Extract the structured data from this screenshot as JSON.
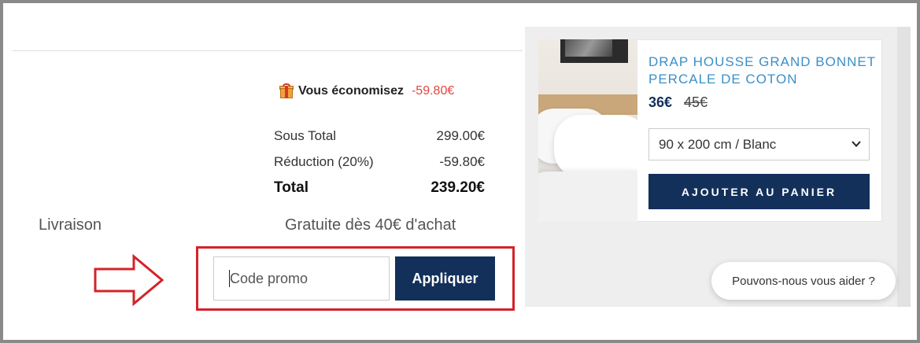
{
  "cart_summary": {
    "savings_label": "Vous économisez",
    "savings_amount": "-59.80€",
    "rows": [
      {
        "label": "Sous Total",
        "value": "299.00€"
      },
      {
        "label": "Réduction (20%)",
        "value": "-59.80€"
      },
      {
        "label": "Total",
        "value": "239.20€"
      }
    ]
  },
  "delivery": {
    "label": "Livraison",
    "value": "Gratuite dès 40€ d'achat"
  },
  "promo": {
    "placeholder": "Code promo",
    "value": "",
    "apply_label": "Appliquer"
  },
  "product": {
    "title": "DRAP HOUSSE GRAND BONNET PERCALE DE COTON",
    "price_new": "36€",
    "price_old": "45€",
    "variant": "90 x 200 cm / Blanc",
    "add_to_cart_label": "AJOUTER AU PANIER"
  },
  "chat": {
    "prompt": "Pouvons-nous vous aider ?"
  },
  "colors": {
    "primary": "#12305a",
    "accent_blue": "#3a8fc7",
    "discount_red": "#e0483e",
    "highlight_red": "#d3232a"
  }
}
